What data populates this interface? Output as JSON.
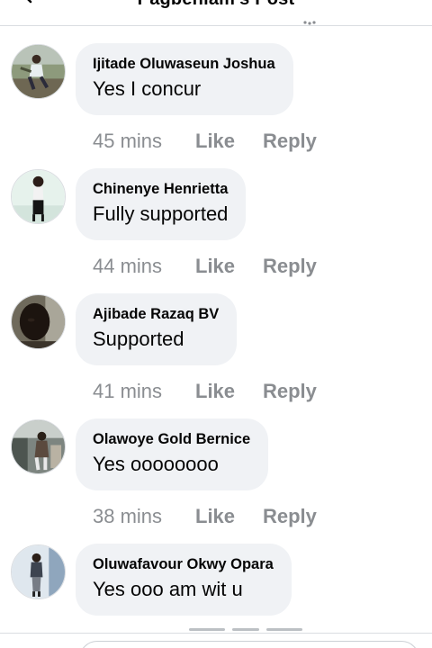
{
  "header": {
    "title": "Pagbeniam's Post"
  },
  "comments": [
    {
      "author": "Ijitade Oluwaseun Joshua",
      "text": "Yes I concur",
      "time": "45 mins",
      "like": "Like",
      "reply": "Reply"
    },
    {
      "author": "Chinenye Henrietta",
      "text": "Fully supported",
      "time": "44 mins",
      "like": "Like",
      "reply": "Reply"
    },
    {
      "author": "Ajibade Razaq BV",
      "text": "Supported",
      "time": "41 mins",
      "like": "Like",
      "reply": "Reply"
    },
    {
      "author": "Olawoye Gold Bernice",
      "text": "Yes oooooooo",
      "time": "38 mins",
      "like": "Like",
      "reply": "Reply"
    },
    {
      "author": "Oluwafavour Okwy Opara",
      "text": "Yes ooo am wit u",
      "time": "",
      "like": "",
      "reply": ""
    }
  ],
  "icons": {
    "back": "back-arrow-icon",
    "more": "more-dots-icon"
  },
  "colors": {
    "bubble": "#f0f2f5",
    "meta_text": "#8a8d91",
    "divider": "#dadde1"
  }
}
